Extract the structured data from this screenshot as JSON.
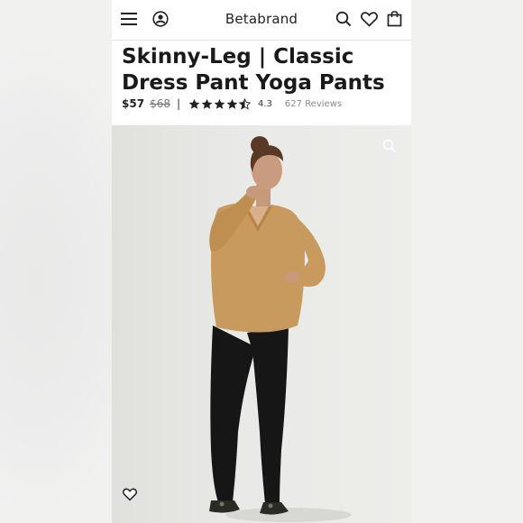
{
  "header": {
    "brand": "Betabrand",
    "icons": [
      "menu-icon",
      "account-icon",
      "search-icon",
      "heart-icon",
      "bag-icon"
    ]
  },
  "product": {
    "title": "Skinny-Leg | Classic Dress Pant Yoga Pants",
    "price": "$57",
    "original_price": "$68",
    "separator": "|",
    "rating": "4.3",
    "stars": 4.5,
    "reviews": "627 Reviews"
  },
  "image": {
    "icons": [
      "zoom-icon",
      "favorite-heart-icon"
    ],
    "sweater_color": "#c99a5e",
    "pants_color": "#161616"
  },
  "colors": {
    "text": "#1a1a1a",
    "muted": "#8a8a8a",
    "page_bg": "#f3f3f2"
  }
}
